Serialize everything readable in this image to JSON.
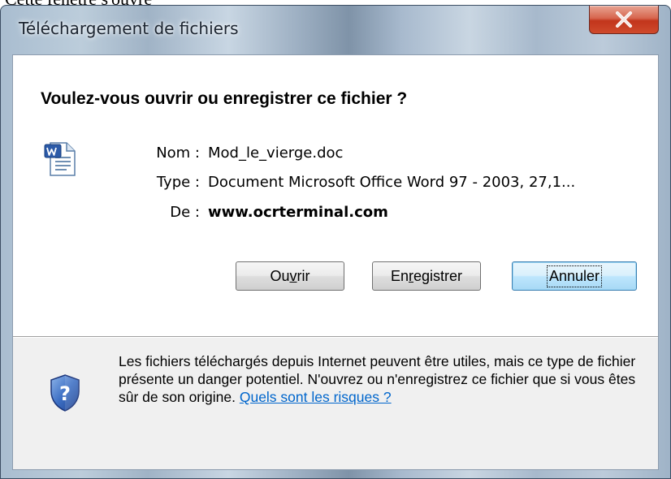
{
  "caption": "Cette fenêtre s'ouvre",
  "window": {
    "title": "Téléchargement de fichiers",
    "close_glyph": "X"
  },
  "dialog": {
    "question": "Voulez-vous ouvrir ou enregistrer ce fichier ?",
    "file_icon": "word-document-icon",
    "fields": {
      "name_label": "Nom :",
      "name_value": "Mod_le_vierge.doc",
      "type_label": "Type :",
      "type_value": "Document Microsoft Office Word 97 - 2003, 27,1...",
      "from_label": "De :",
      "from_value": "www.ocrterminal.com"
    },
    "buttons": {
      "open_pre": "Ou",
      "open_accel": "v",
      "open_post": "rir",
      "save_pre": "En",
      "save_accel": "r",
      "save_post": "egistrer",
      "cancel": "Annuler"
    }
  },
  "warning": {
    "icon": "shield-question-icon",
    "text": "Les fichiers téléchargés depuis Internet peuvent être utiles, mais ce type de fichier présente un danger potentiel. N'ouvrez ou n'enregistrez ce fichier que si vous êtes sûr de son origine. ",
    "link": "Quels sont les risques ?"
  },
  "colors": {
    "link": "#0066cc",
    "close_button": "#c2351c",
    "default_button_border": "#3c7fb1"
  }
}
